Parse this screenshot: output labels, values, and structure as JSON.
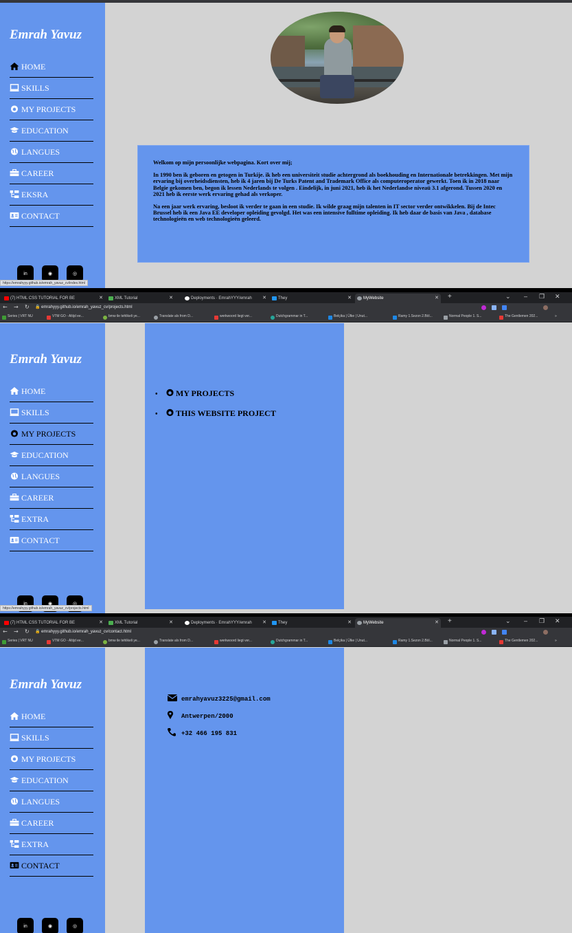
{
  "brand": "Emrah Yavuz",
  "nav": {
    "home": "HOME",
    "skills": "SKILLS",
    "projects": "MY PROJECTS",
    "education": "EDUCATION",
    "langues": "LANGUES",
    "career": "CAREER",
    "extra_p1": "EKSRA",
    "extra": "EXTRA",
    "contact": "CONTACT"
  },
  "social": {
    "linkedin": "in",
    "github": "◉",
    "instagram": "◎"
  },
  "status_urls": {
    "p1": "https://emrahyyy.github.io/emrah_yavuz_cv/index.html",
    "p2": "https://emrahyyy.github.io/emrah_yavuz_cv/projects.html",
    "p3": "https://emrahyyy.github.io/emrah_yavuz_cv/contact.html"
  },
  "browser": {
    "tabs": [
      "(7) HTML CSS TUTORIAL FOR BE",
      "XML Tutorial",
      "Deployments · EmrahYYY/emrah",
      "They",
      "MyWebsite"
    ],
    "url_p2": "emrahyyy.github.io/emrah_yavuz_cv/projects.html",
    "url_p3": "emrahyyy.github.io/emrah_yavuz_cv/contact.html",
    "bookmarks": [
      "Series | VRT NU",
      "VTM GO - Altijd ee...",
      "bmw ile tehlikeli ye...",
      "Translate als from D...",
      "werkwoord liegt ver...",
      "Dutchgrammar in T...",
      "Belçika | Ülke | Unut...",
      "Ramy 1.Sezon 2.Böl...",
      "Normal People 1. S...",
      "The Gentlemen 202..."
    ],
    "more": "»"
  },
  "home": {
    "intro": "Welkom op mijn persoonlijke webpagina. Kort over mij;",
    "para1": "In 1990 ben ik geboren en getogen in Turkije. ik heb een universiteit studie achtergrond als boekhouding en Internationale betrekkingen. Met mijn ervaring bij overheidsdiensten, heb ik 4 jaren bij De Turks Patent and Trademark Office als computeroperator gewerkt. Toen ik in 2018 naar Belgie gekomen ben, begon ik lessen Nederlands te volgen . Eindelijk, in juni 2021, heb ik het Nederlandse niveaü 3.1 afgerond. Tussen 2020 en 2021 heb ik eerste werk ervaring gehad als verkoper.",
    "para2": "Na een jaar werk ervaring, besloot ik verder te gaan in een studie. Ik wilde graag mijn talenten in IT sector verder ontwikkelen. Bij de Intec Brussel heb ik een Java EE developer opleiding gevolgd. Het was een intensive fulltime opleiding. Ik heb daar de basis van Java , database technologieën en web technologieën geleerd."
  },
  "projects": {
    "items": [
      "MY PROJECTS",
      "THIS WEBSITE PROJECT"
    ]
  },
  "contact": {
    "email": "emrahyavuz3225@gmail.com",
    "location": "Antwerpen/2000",
    "phone": "+32 466 195 831"
  },
  "colors": {
    "sidebar": "#6495ed",
    "page_bg": "#d3d3d3"
  }
}
